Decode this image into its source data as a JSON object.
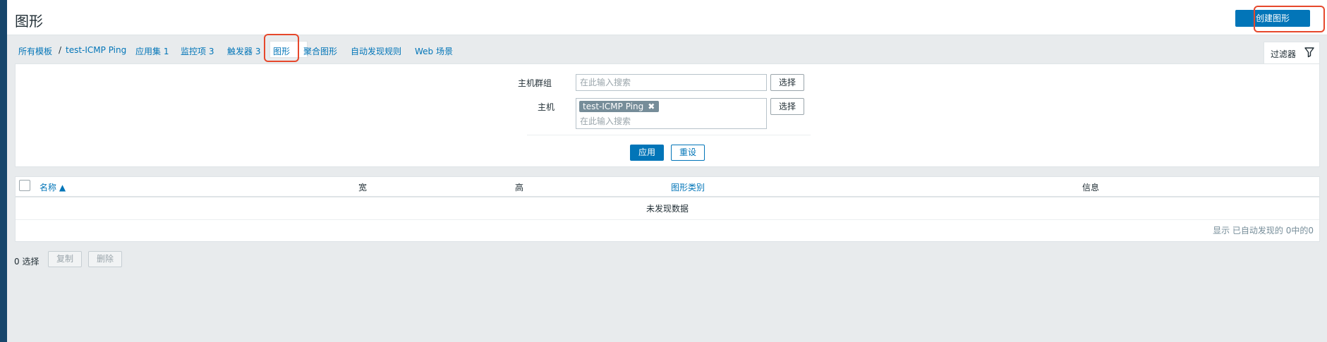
{
  "header": {
    "title": "图形",
    "create_label": "创建图形"
  },
  "nav": {
    "all_templates": "所有模板",
    "template_name": "test-ICMP Ping",
    "applications_label": "应用集",
    "applications_count": "1",
    "items_label": "监控项",
    "items_count": "3",
    "triggers_label": "触发器",
    "triggers_count": "3",
    "graphs_label": "图形",
    "screens_label": "聚合图形",
    "discovery_label": "自动发现规则",
    "web_label": "Web 场景"
  },
  "filter": {
    "tab_label": "过滤器",
    "host_group_label": "主机群组",
    "host_group_placeholder": "在此输入搜索",
    "host_label": "主机",
    "host_chip": "test-ICMP Ping",
    "host_placeholder": "在此输入搜索",
    "select_label": "选择",
    "apply_label": "应用",
    "reset_label": "重设"
  },
  "table": {
    "columns": [
      "名称 ▲",
      "宽",
      "高",
      "图形类别",
      "信息"
    ],
    "empty_text": "未发现数据",
    "footer_text": "显示 已自动发现的 0中的0"
  },
  "actions": {
    "selected_count": "0 选择",
    "copy_label": "复制",
    "delete_label": "删除"
  },
  "colors": {
    "accent": "#0275b8",
    "highlight": "#e6482c",
    "sidebar": "#17466b"
  }
}
